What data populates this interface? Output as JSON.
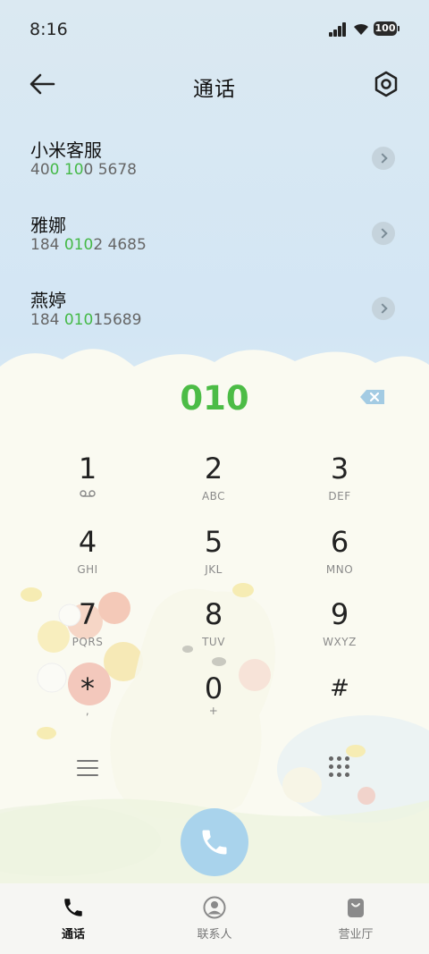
{
  "status_bar": {
    "time": "8:16",
    "battery": "100"
  },
  "header": {
    "title": "通话"
  },
  "contacts": [
    {
      "name": "小米客服",
      "number_parts": [
        "40",
        "0",
        " ",
        "10",
        "0 5678"
      ]
    },
    {
      "name": "雅娜",
      "number_parts": [
        "184 ",
        "010",
        "2 4685"
      ]
    },
    {
      "name": "燕婷",
      "number_parts": [
        "184 ",
        "010",
        "15689"
      ]
    }
  ],
  "dialpad": {
    "entered": "010",
    "keys": [
      {
        "digit": "1",
        "letters": ""
      },
      {
        "digit": "2",
        "letters": "ABC"
      },
      {
        "digit": "3",
        "letters": "DEF"
      },
      {
        "digit": "4",
        "letters": "GHI"
      },
      {
        "digit": "5",
        "letters": "JKL"
      },
      {
        "digit": "6",
        "letters": "MNO"
      },
      {
        "digit": "7",
        "letters": "PQRS"
      },
      {
        "digit": "8",
        "letters": "TUV"
      },
      {
        "digit": "9",
        "letters": "WXYZ"
      },
      {
        "digit": "*",
        "letters": ","
      },
      {
        "digit": "0",
        "letters": "+"
      },
      {
        "digit": "#",
        "letters": ""
      }
    ]
  },
  "bottom_nav": [
    {
      "label": "通话",
      "icon": "phone-icon",
      "active": true
    },
    {
      "label": "联系人",
      "icon": "person-icon",
      "active": false
    },
    {
      "label": "营业厅",
      "icon": "bag-icon",
      "active": false
    }
  ],
  "colors": {
    "match_highlight": "#45b947",
    "call_button": "#a9d3ec"
  }
}
